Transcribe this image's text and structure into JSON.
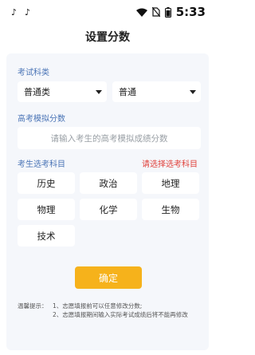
{
  "status": {
    "time": "5:33",
    "app_icons": [
      "tiktok-icon",
      "tiktok-icon"
    ],
    "sys_icons": [
      "wifi-icon",
      "no-sim-icon",
      "battery-icon"
    ]
  },
  "header": {
    "title": "设置分数"
  },
  "exam_subject_type": {
    "label": "考试科类",
    "category_value": "普通类",
    "subtype_value": "普通"
  },
  "mock_score": {
    "label": "高考模拟分数",
    "placeholder": "请输入考生的高考模拟成绩分数"
  },
  "elective": {
    "label": "考生选考科目",
    "hint": "请选择选考科目",
    "subjects": [
      "历史",
      "政治",
      "地理",
      "物理",
      "化学",
      "生物",
      "技术"
    ]
  },
  "actions": {
    "confirm_label": "确定"
  },
  "tips": {
    "lead": "温馨提示：",
    "lines": [
      "1、志愿填报前可以任意修改分数;",
      "2、志愿填报期间输入实际考试成绩后将不能再修改"
    ]
  },
  "colors": {
    "accent": "#4a74b6",
    "warning": "#e0413b",
    "button": "#f6b21b",
    "panel": "#f5f7fb"
  }
}
